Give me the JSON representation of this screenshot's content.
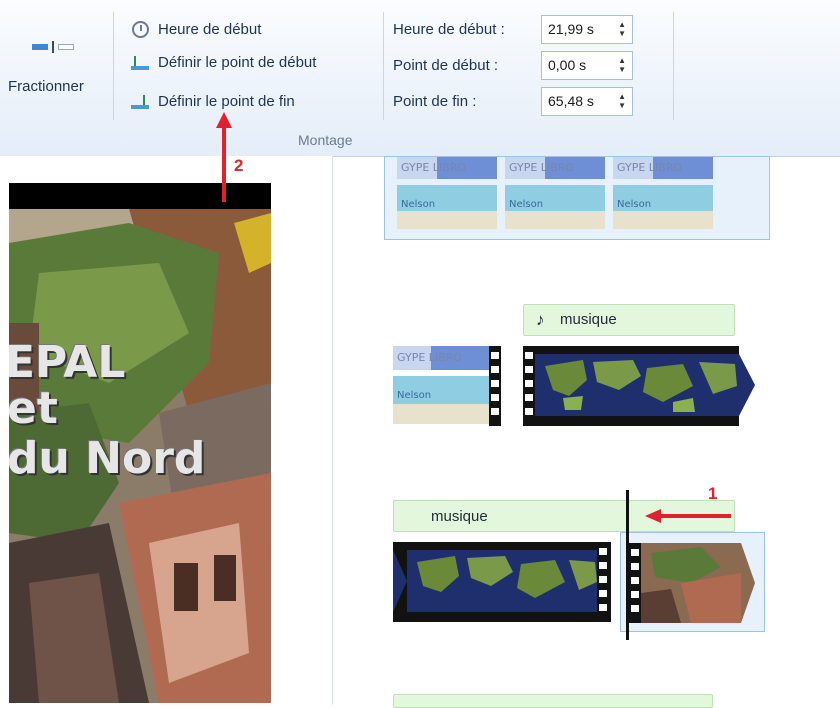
{
  "ribbon": {
    "split_label": "Fractionner",
    "start_time_button": "Heure de début",
    "set_start_point": "Définir le point de début",
    "set_end_point": "Définir le point de fin",
    "group_label": "Montage",
    "fields": {
      "start_time": {
        "label": "Heure de début :",
        "value": "21,99 s"
      },
      "start_point": {
        "label": "Point de début :",
        "value": "0,00 s"
      },
      "end_point": {
        "label": "Point de fin :",
        "value": "65,48 s"
      }
    }
  },
  "preview": {
    "overlay_lines": [
      "EPAL",
      "et",
      "du Nord"
    ]
  },
  "timeline": {
    "clips": [
      {
        "caption": "musique",
        "caption_icon": "music-note-icon"
      },
      {
        "caption": "musique"
      }
    ]
  },
  "annotations": {
    "marker_1": "1",
    "marker_2": "2",
    "color": "#e0212f"
  }
}
